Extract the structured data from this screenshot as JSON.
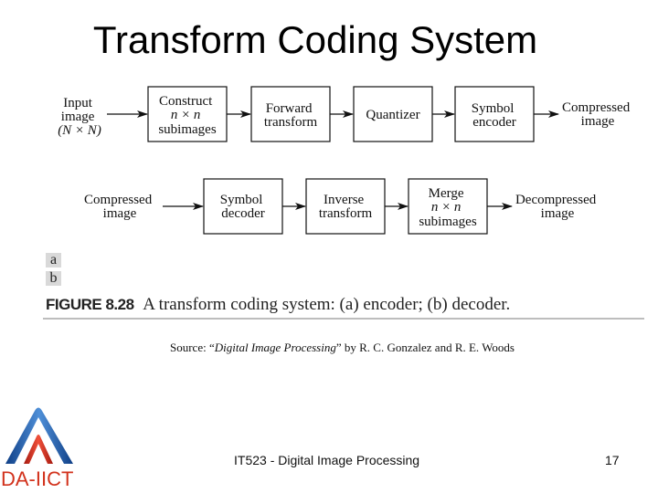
{
  "slide": {
    "title": "Transform Coding System",
    "footer_center": "IT523 - Digital Image Processing",
    "page_number": "17",
    "logo_text": "DA-IICT"
  },
  "figure": {
    "encoder": {
      "input": [
        "Input",
        "image",
        "(N × N)"
      ],
      "blocks": [
        [
          "Construct",
          "n × n",
          "subimages"
        ],
        [
          "Forward",
          "transform"
        ],
        [
          "Quantizer"
        ],
        [
          "Symbol",
          "encoder"
        ]
      ],
      "output": [
        "Compressed",
        "image"
      ]
    },
    "decoder": {
      "input": [
        "Compressed",
        "image"
      ],
      "blocks": [
        [
          "Symbol",
          "decoder"
        ],
        [
          "Inverse",
          "transform"
        ],
        [
          "Merge",
          "n × n",
          "subimages"
        ]
      ],
      "output": [
        "Decompressed",
        "image"
      ]
    },
    "panel_labels": [
      "a",
      "b"
    ],
    "caption_label": "FIGURE 8.28",
    "caption_text": "A transform coding system: (a) encoder; (b) decoder."
  },
  "source": {
    "prefix": "Source:  “",
    "book": "Digital Image Processing",
    "suffix": "” by R. C. Gonzalez and R. E. Woods"
  },
  "colors": {
    "logo_blue": "#1f5fae",
    "logo_red": "#d2321c",
    "caption_rule": "#bdbdbd"
  }
}
